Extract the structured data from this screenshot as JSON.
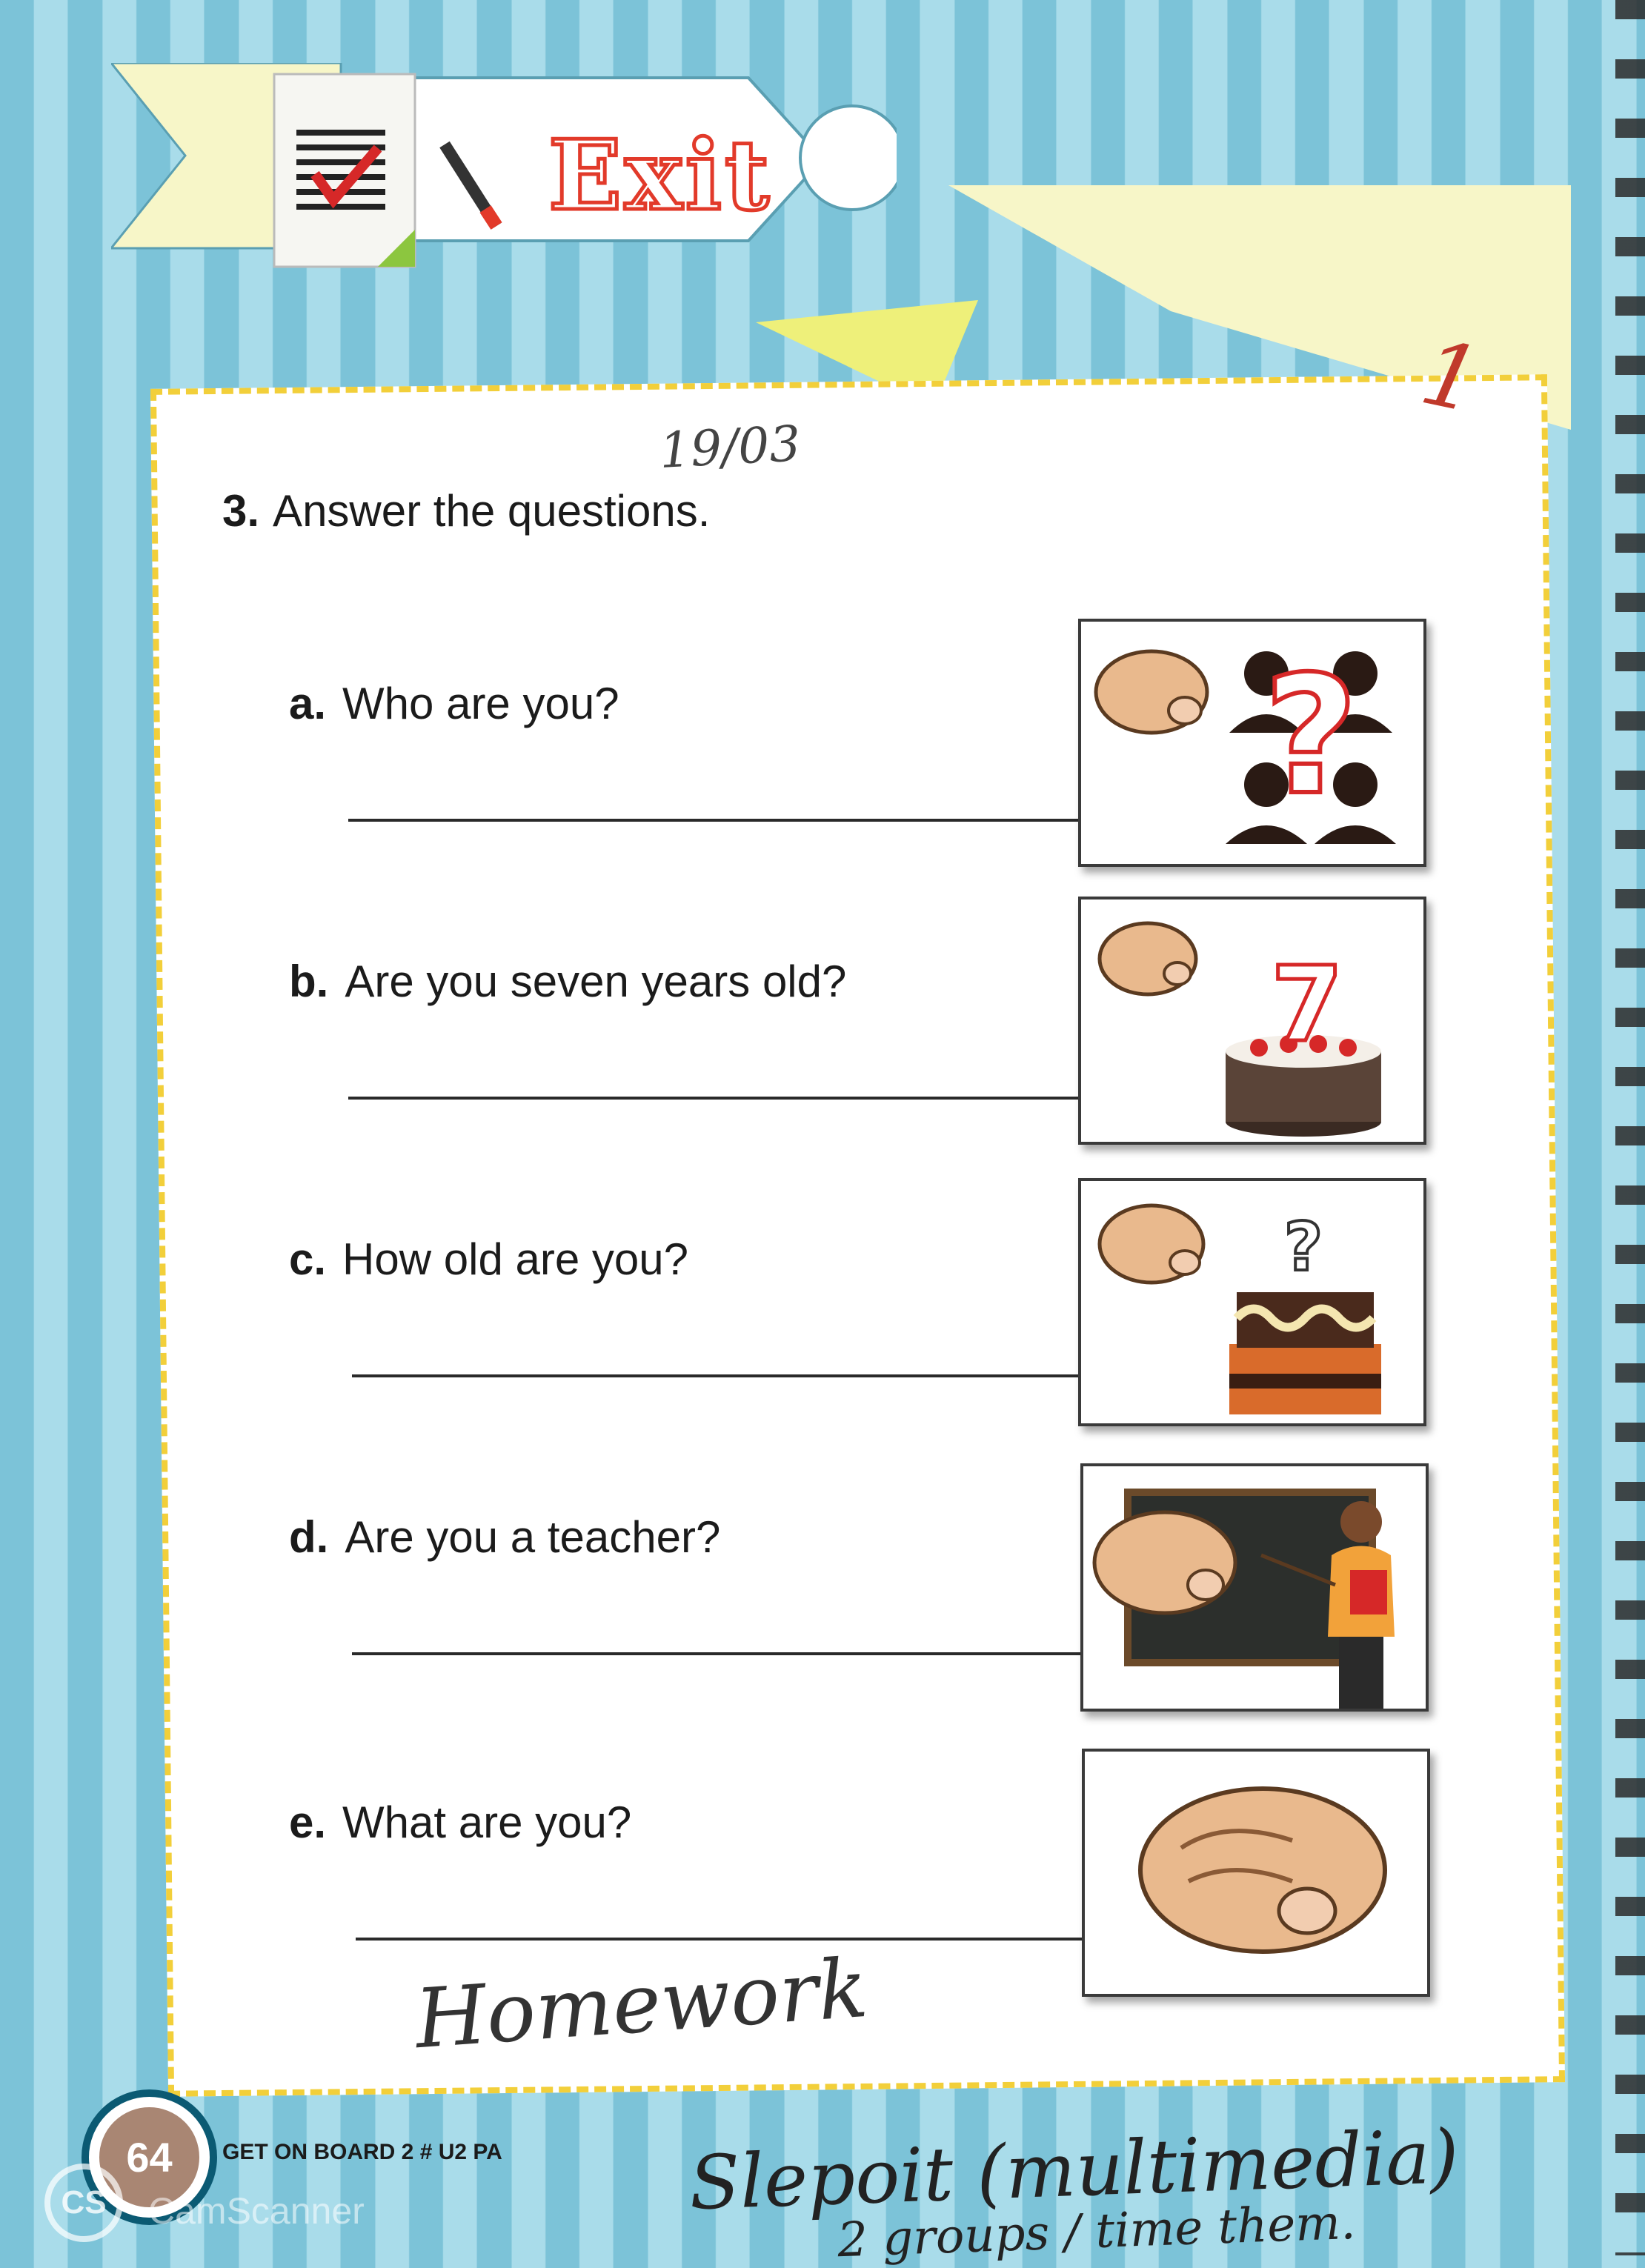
{
  "banner": {
    "title": "Exit"
  },
  "handwriting": {
    "date": "19/03",
    "score": "1",
    "homework": "Homework",
    "bottom_line1": "Slepoit (multimedia)",
    "bottom_line2": "2 groups / time them."
  },
  "exercise": {
    "number": "3.",
    "instruction": "Answer the questions.",
    "questions": [
      {
        "letter": "a.",
        "text": "Who are you?"
      },
      {
        "letter": "b.",
        "text": "Are you seven years old?"
      },
      {
        "letter": "c.",
        "text": "How old are you?"
      },
      {
        "letter": "d.",
        "text": "Are you a teacher?"
      },
      {
        "letter": "e.",
        "text": "What are you?"
      }
    ]
  },
  "footer": {
    "page_number": "64",
    "book": "GET ON BOARD 2 # U2 PA"
  },
  "watermark": {
    "badge": "CS",
    "text": "CamScanner"
  },
  "icons": [
    "pointing-hand-icon",
    "silhouettes-question-icon",
    "birthday-cake-seven-icon",
    "cake-question-icon",
    "teacher-blackboard-icon",
    "checklist-icon",
    "pencil-icon"
  ]
}
